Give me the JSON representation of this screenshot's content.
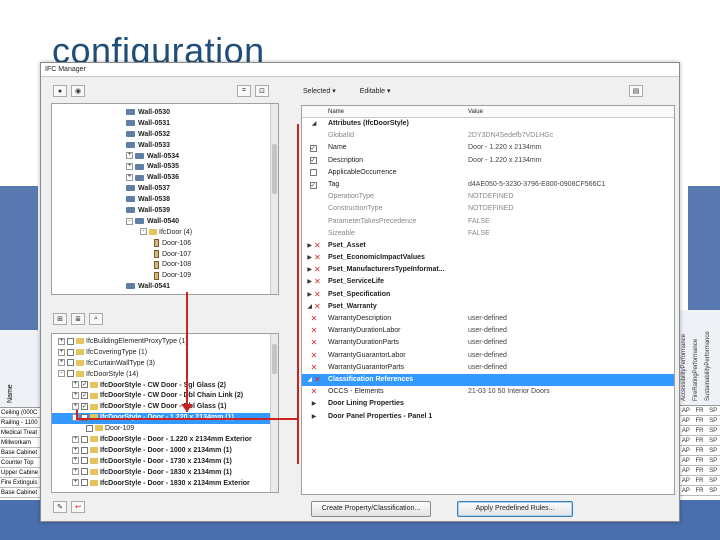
{
  "slide_title": "configuration",
  "window_title": "IFC Manager",
  "colors": {
    "accent_blue": "#3399ff",
    "slide_title": "#1f4e79",
    "red_annotation": "#cc2222",
    "red_x": "#d62a2a"
  },
  "tree": [
    {
      "label": "Wall-0530",
      "indent": 0,
      "expander": "",
      "icon": "wall"
    },
    {
      "label": "Wall-0531",
      "indent": 0,
      "expander": "",
      "icon": "wall"
    },
    {
      "label": "Wall-0532",
      "indent": 0,
      "expander": "",
      "icon": "wall"
    },
    {
      "label": "Wall-0533",
      "indent": 0,
      "expander": "",
      "icon": "wall"
    },
    {
      "label": "Wall-0534",
      "indent": 0,
      "expander": "+",
      "icon": "wall"
    },
    {
      "label": "Wall-0535",
      "indent": 0,
      "expander": "+",
      "icon": "wall"
    },
    {
      "label": "Wall-0536",
      "indent": 0,
      "expander": "+",
      "icon": "wall"
    },
    {
      "label": "Wall-0537",
      "indent": 0,
      "expander": "",
      "icon": "wall"
    },
    {
      "label": "Wall-0538",
      "indent": 0,
      "expander": "",
      "icon": "wall"
    },
    {
      "label": "Wall-0539",
      "indent": 0,
      "expander": "",
      "icon": "wall"
    },
    {
      "label": "Wall-0540",
      "indent": 0,
      "expander": "-",
      "icon": "wall"
    },
    {
      "label": "IfcDoor (4)",
      "indent": 1,
      "expander": "-",
      "icon": "folder"
    },
    {
      "label": "Door-106",
      "indent": 2,
      "expander": "",
      "icon": "door"
    },
    {
      "label": "Door-107",
      "indent": 2,
      "expander": "",
      "icon": "door"
    },
    {
      "label": "Door-108",
      "indent": 2,
      "expander": "",
      "icon": "door"
    },
    {
      "label": "Door-109",
      "indent": 2,
      "expander": "",
      "icon": "door"
    },
    {
      "label": "Wall-0541",
      "indent": 0,
      "expander": "",
      "icon": "wall"
    }
  ],
  "type_list": [
    {
      "label": "IfcBuildingElementProxyType (1)",
      "indent": 0,
      "expander": "+",
      "checked": false,
      "selected": false
    },
    {
      "label": "IfcCoveringType (1)",
      "indent": 0,
      "expander": "+",
      "checked": false,
      "selected": false
    },
    {
      "label": "IfcCurtainWallType (3)",
      "indent": 0,
      "expander": "+",
      "checked": false,
      "selected": false
    },
    {
      "label": "IfcDoorStyle (14)",
      "indent": 0,
      "expander": "-",
      "checked": false,
      "selected": false
    },
    {
      "label": "IfcDoorStyle - CW Door - Sgl Glass (2)",
      "indent": 1,
      "expander": "+",
      "checked": true,
      "selected": false
    },
    {
      "label": "IfcDoorStyle - CW Door - Dbl Chain Link (2)",
      "indent": 1,
      "expander": "+",
      "checked": true,
      "selected": false
    },
    {
      "label": "IfcDoorStyle - CW Door - Dbl Glass (1)",
      "indent": 1,
      "expander": "+",
      "checked": true,
      "selected": false
    },
    {
      "label": "IfcDoorStyle - Door - 1.220 x 2134mm (1)",
      "indent": 1,
      "expander": "-",
      "checked": true,
      "selected": true
    },
    {
      "label": "Door-109",
      "indent": 2,
      "expander": "",
      "checked": false,
      "selected": false
    },
    {
      "label": "IfcDoorStyle - Door - 1.220 x 2134mm Exterior",
      "indent": 1,
      "expander": "+",
      "checked": false,
      "selected": false
    },
    {
      "label": "IfcDoorStyle - Door - 1000 x 2134mm (1)",
      "indent": 1,
      "expander": "+",
      "checked": false,
      "selected": false
    },
    {
      "label": "IfcDoorStyle - Door - 1730 x 2134mm (1)",
      "indent": 1,
      "expander": "+",
      "checked": false,
      "selected": false
    },
    {
      "label": "IfcDoorStyle - Door - 1830 x 2134mm (1)",
      "indent": 1,
      "expander": "+",
      "checked": false,
      "selected": false
    },
    {
      "label": "IfcDoorStyle - Door - 1830 x 2134mm Exterior",
      "indent": 1,
      "expander": "+",
      "checked": false,
      "selected": false
    }
  ],
  "prop_toolbar": {
    "selected_label": "Selected",
    "editable_label": "Editable"
  },
  "grid_headers": {
    "name": "Name",
    "value": "Value"
  },
  "props": [
    {
      "kind": "group",
      "lead": "triangle-down",
      "check": false,
      "name": "Attributes (IfcDoorStyle)",
      "value": ""
    },
    {
      "kind": "sub",
      "lead": "",
      "check": false,
      "name": "GlobalId",
      "value": "2DY3DN4Sedefb7VDLHGc"
    },
    {
      "kind": "item",
      "lead": "",
      "check": true,
      "name": "Name",
      "value": "Door - 1.220 x 2134mm"
    },
    {
      "kind": "item",
      "lead": "",
      "check": true,
      "name": "Description",
      "value": "Door - 1.220 x 2134mm"
    },
    {
      "kind": "item",
      "lead": "",
      "check": false,
      "name": "ApplicableOccurrence",
      "value": ""
    },
    {
      "kind": "item",
      "lead": "",
      "check": true,
      "name": "Tag",
      "value": "d4AE050-5-3230-3796-E800-0908CF566C1"
    },
    {
      "kind": "sub",
      "lead": "",
      "check": false,
      "name": "OperationType",
      "value": "NOTDEFINED"
    },
    {
      "kind": "sub",
      "lead": "",
      "check": false,
      "name": "ConstructionType",
      "value": "NOTDEFINED"
    },
    {
      "kind": "sub",
      "lead": "",
      "check": false,
      "name": "ParameterTakesPrecedence",
      "value": "FALSE"
    },
    {
      "kind": "sub",
      "lead": "",
      "check": false,
      "name": "Sizeable",
      "value": "FALSE"
    },
    {
      "kind": "group",
      "lead": "triangle-right",
      "check": false,
      "x": true,
      "name": "Pset_Asset",
      "value": ""
    },
    {
      "kind": "group",
      "lead": "triangle-right",
      "check": false,
      "x": true,
      "name": "Pset_EconomicImpactValues",
      "value": ""
    },
    {
      "kind": "group",
      "lead": "triangle-right",
      "check": false,
      "x": true,
      "name": "Pset_ManufacturersTypeInformat...",
      "value": ""
    },
    {
      "kind": "group",
      "lead": "triangle-right",
      "check": false,
      "x": true,
      "name": "Pset_ServiceLife",
      "value": ""
    },
    {
      "kind": "group",
      "lead": "triangle-right",
      "check": false,
      "x": true,
      "name": "Pset_Specification",
      "value": ""
    },
    {
      "kind": "group",
      "lead": "triangle-down",
      "check": false,
      "x": true,
      "name": "Pset_Warranty",
      "value": ""
    },
    {
      "kind": "item",
      "lead": "",
      "check": false,
      "x": true,
      "name": "WarrantyDescription",
      "value": "user-defined"
    },
    {
      "kind": "item",
      "lead": "",
      "check": false,
      "x": true,
      "name": "WarrantyDurationLabor",
      "value": "user-defined"
    },
    {
      "kind": "item",
      "lead": "",
      "check": false,
      "x": true,
      "name": "WarrantyDurationParts",
      "value": "user-defined"
    },
    {
      "kind": "item",
      "lead": "",
      "check": false,
      "x": true,
      "name": "WarrantyGuarantorLabor",
      "value": "user-defined"
    },
    {
      "kind": "item",
      "lead": "",
      "check": false,
      "x": true,
      "name": "WarrantyGuarantorParts",
      "value": "user-defined"
    },
    {
      "kind": "sel",
      "lead": "triangle-down",
      "check": false,
      "x": true,
      "name": "Classification References",
      "value": ""
    },
    {
      "kind": "item",
      "lead": "",
      "check": false,
      "x": true,
      "name": "OCCS - Elements",
      "value": "21-03 10 50 Interior Doors"
    },
    {
      "kind": "group",
      "lead": "triangle-right",
      "check": false,
      "name": "Door Lining Properties",
      "value": ""
    },
    {
      "kind": "group",
      "lead": "triangle-right",
      "check": false,
      "name": "Door Panel Properties - Panel 1",
      "value": ""
    }
  ],
  "buttons": {
    "create_property": "Create Property/Classification...",
    "apply_rules": "Apply Predefined Rules..."
  },
  "left_sheet": {
    "header": "Name",
    "rows": [
      "Ceiling (000C",
      "Railing - 1100",
      "Medical Treat",
      "Millworkam",
      "Base Cabinet",
      "Counter Top",
      "Upper Cabine",
      "Fire Extinguis",
      "Base Cabinet"
    ]
  },
  "right_sheet": {
    "headers": [
      "AccessibilityPerformance",
      "FireRatingPerformance",
      "SustainabilityPerformance"
    ],
    "rows": [
      [
        "AP",
        "FR",
        "SP"
      ],
      [
        "AP",
        "FR",
        "SP"
      ],
      [
        "AP",
        "FR",
        "SP"
      ],
      [
        "AP",
        "FR",
        "SP"
      ],
      [
        "AP",
        "FR",
        "SP"
      ],
      [
        "AP",
        "FR",
        "SP"
      ],
      [
        "AP",
        "FR",
        "SP"
      ],
      [
        "AP",
        "FR",
        "SP"
      ],
      [
        "AP",
        "FR",
        "SP"
      ]
    ]
  }
}
